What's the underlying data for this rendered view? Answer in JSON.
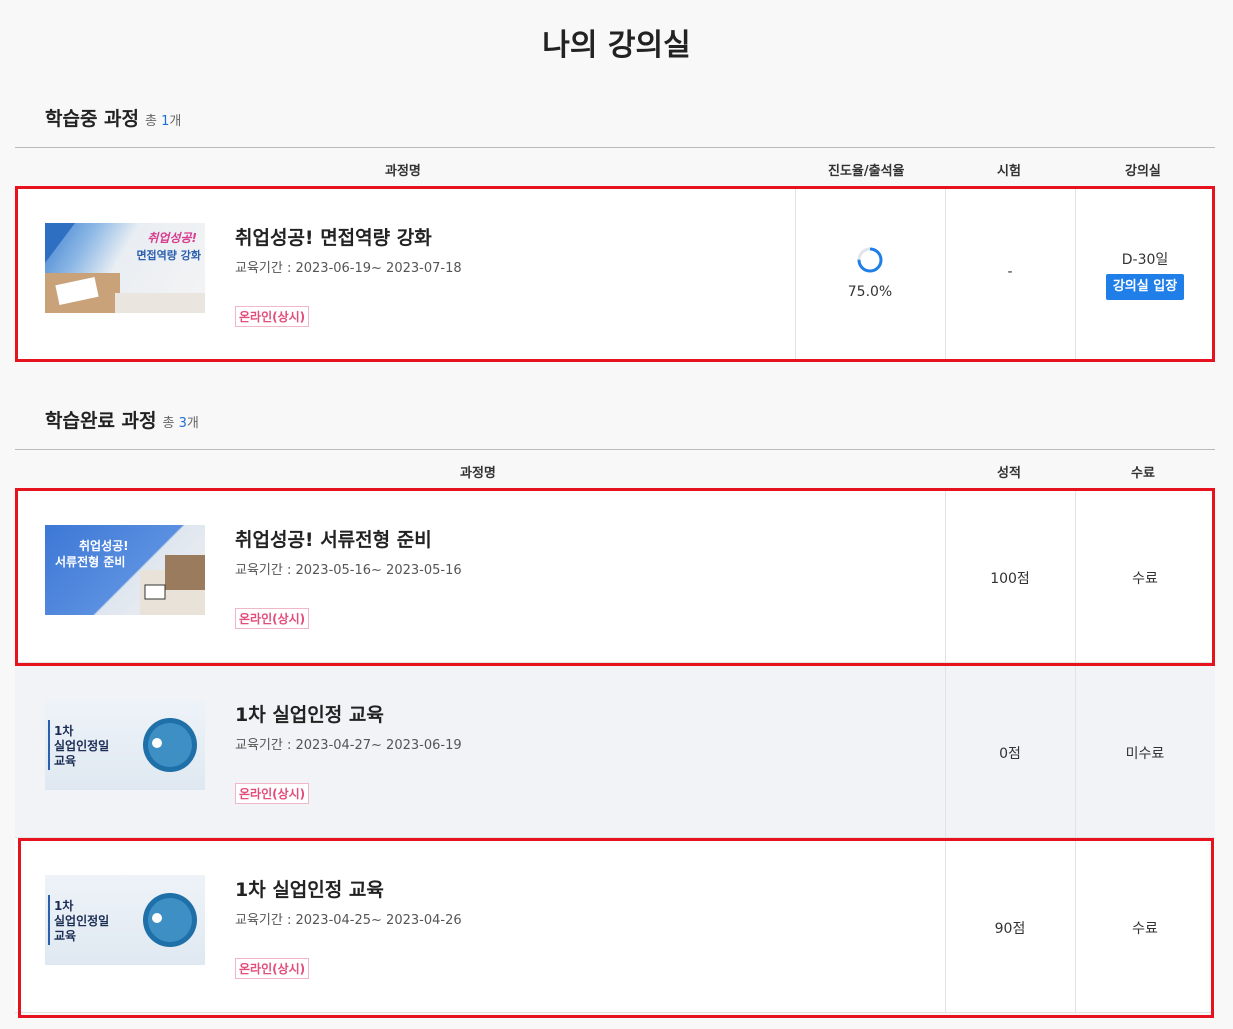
{
  "page": {
    "title": "나의 강의실"
  },
  "in_progress": {
    "heading": "학습중 과정",
    "count_prefix": "총",
    "count": "1",
    "count_suffix": "개",
    "columns": {
      "name": "과정명",
      "progress": "진도율/출석율",
      "exam": "시험",
      "room": "강의실"
    },
    "courses": [
      {
        "title": "취업성공! 면접역량 강화",
        "period": "교육기간 : 2023-06-19~ 2023-07-18",
        "tag": "온라인(상시)",
        "progress_value": 75.0,
        "progress_text": "75.0%",
        "exam": "-",
        "dday": "D-30일",
        "enter_label": "강의실 입장",
        "thumb_text_1": "취업성공!",
        "thumb_text_2": "면접역량 강화"
      }
    ]
  },
  "completed": {
    "heading": "학습완료 과정",
    "count_prefix": "총",
    "count": "3",
    "count_suffix": "개",
    "columns": {
      "name": "과정명",
      "score": "성적",
      "status": "수료"
    },
    "courses": [
      {
        "title": "취업성공! 서류전형 준비",
        "period": "교육기간 : 2023-05-16~ 2023-05-16",
        "tag": "온라인(상시)",
        "score": "100점",
        "status": "수료",
        "thumb_text_1": "취업성공!",
        "thumb_text_2": "서류전형 준비"
      },
      {
        "title": "1차 실업인정 교육",
        "period": "교육기간 : 2023-04-27~ 2023-06-19",
        "tag": "온라인(상시)",
        "score": "0점",
        "status": "미수료",
        "thumb_text_1": "1차",
        "thumb_text_2": "실업인정일",
        "thumb_text_3": "교육"
      },
      {
        "title": "1차 실업인정 교육",
        "period": "교육기간 : 2023-04-25~ 2023-04-26",
        "tag": "온라인(상시)",
        "score": "90점",
        "status": "수료",
        "thumb_text_1": "1차",
        "thumb_text_2": "실업인정일",
        "thumb_text_3": "교육"
      }
    ]
  },
  "colors": {
    "accent": "#1f7ee8",
    "tag": "#e24d7b",
    "highlight": "#e6131e"
  }
}
